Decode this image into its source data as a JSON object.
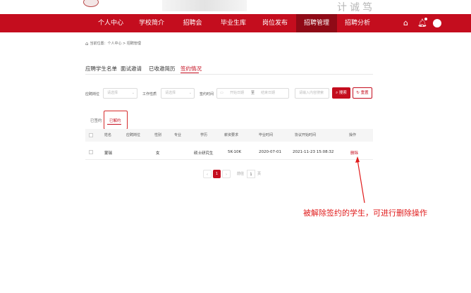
{
  "banner": {
    "calligraphy": "计诚笃"
  },
  "nav": {
    "items": [
      "个人中心",
      "学校简介",
      "招聘会",
      "毕业生库",
      "岗位发布",
      "招聘管理",
      "招聘分析"
    ],
    "active_index": 5,
    "icons": [
      "home-icon",
      "bell-icon",
      "avatar"
    ]
  },
  "breadcrumb": {
    "prefix": "当前位置：",
    "path": "个人中心 > 招聘管理"
  },
  "tabs": [
    "应聘学生名单",
    "面试邀请",
    "已收邀简历",
    "签约情况"
  ],
  "filters": {
    "position_label": "应聘岗位",
    "position_placeholder": "请选择",
    "job_type_label": "工作性质",
    "job_type_placeholder": "请选择",
    "sign_time_label": "签约时间",
    "start_placeholder": "开始日期",
    "range_sep": "至",
    "end_placeholder": "结束日期",
    "keyword_placeholder": "请输入内容搜索",
    "search_label": "搜索",
    "reset_label": "重置"
  },
  "subtabs": [
    "已签约",
    "已解约"
  ],
  "table": {
    "headers": [
      "姓名",
      "应聘岗位",
      "性别",
      "专业",
      "学历",
      "薪资要求",
      "毕业时间",
      "协议开始时间",
      "操作"
    ],
    "rows": [
      {
        "name": "蒙瑞",
        "position": "",
        "gender": "女",
        "major": "",
        "education": "硕士研究生",
        "salary": "5K-10K",
        "grad": "2020-07-01",
        "start": "2021-11-23 15:08:32",
        "action": "删除"
      }
    ]
  },
  "pagination": {
    "current": "1",
    "goto_label": "前往",
    "goto_value": "1",
    "page_suffix": "页"
  },
  "annotation": {
    "text": "被解除签约的学生，可进行删除操作",
    "color": "#e01b1b"
  },
  "colors": {
    "brand": "#c40d1e",
    "nav_active": "#8f0a16"
  }
}
